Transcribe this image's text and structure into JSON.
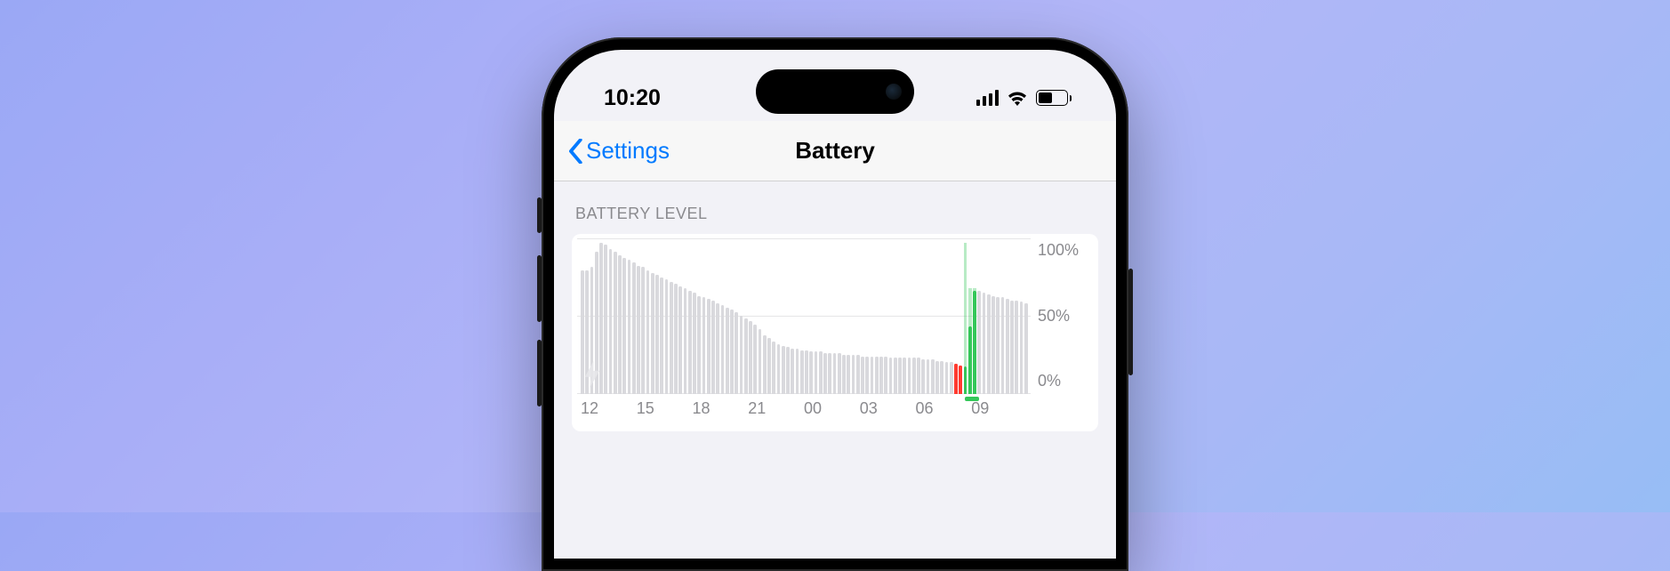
{
  "status_bar": {
    "time": "10:20",
    "cellular_bars": 4,
    "battery_percent": 50
  },
  "nav": {
    "back_label": "Settings",
    "title": "Battery"
  },
  "section": {
    "header": "BATTERY LEVEL"
  },
  "chart_data": {
    "type": "bar",
    "title": "Battery Level",
    "ylabel": "%",
    "ylim": [
      0,
      100
    ],
    "y_ticks": [
      "100%",
      "50%",
      "0%"
    ],
    "x_ticks": [
      "12",
      "15",
      "18",
      "21",
      "00",
      "03",
      "06",
      "09"
    ],
    "series": [
      {
        "name": "battery_level",
        "note": "one sample per ~15 min starting ~10:30 prev day; color=state (gray normal, red low, green charging); charged_to = level reached while plugged in during that interval",
        "points": [
          {
            "t": "10:30",
            "v": 82,
            "color": "gray"
          },
          {
            "t": "10:45",
            "v": 82,
            "color": "gray"
          },
          {
            "t": "11:00",
            "v": 84,
            "color": "gray"
          },
          {
            "t": "11:15",
            "v": 94,
            "color": "gray"
          },
          {
            "t": "11:30",
            "v": 100,
            "color": "gray"
          },
          {
            "t": "11:45",
            "v": 99,
            "color": "gray"
          },
          {
            "t": "12:00",
            "v": 96,
            "color": "gray"
          },
          {
            "t": "12:15",
            "v": 94,
            "color": "gray"
          },
          {
            "t": "12:30",
            "v": 92,
            "color": "gray"
          },
          {
            "t": "12:45",
            "v": 90,
            "color": "gray"
          },
          {
            "t": "13:00",
            "v": 89,
            "color": "gray"
          },
          {
            "t": "13:15",
            "v": 87,
            "color": "gray"
          },
          {
            "t": "13:30",
            "v": 85,
            "color": "gray"
          },
          {
            "t": "13:45",
            "v": 84,
            "color": "gray"
          },
          {
            "t": "14:00",
            "v": 82,
            "color": "gray"
          },
          {
            "t": "14:15",
            "v": 80,
            "color": "gray"
          },
          {
            "t": "14:30",
            "v": 79,
            "color": "gray"
          },
          {
            "t": "14:45",
            "v": 77,
            "color": "gray"
          },
          {
            "t": "15:00",
            "v": 76,
            "color": "gray"
          },
          {
            "t": "15:15",
            "v": 74,
            "color": "gray"
          },
          {
            "t": "15:30",
            "v": 73,
            "color": "gray"
          },
          {
            "t": "15:45",
            "v": 71,
            "color": "gray"
          },
          {
            "t": "16:00",
            "v": 70,
            "color": "gray"
          },
          {
            "t": "16:15",
            "v": 68,
            "color": "gray"
          },
          {
            "t": "16:30",
            "v": 67,
            "color": "gray"
          },
          {
            "t": "16:45",
            "v": 65,
            "color": "gray"
          },
          {
            "t": "17:00",
            "v": 64,
            "color": "gray"
          },
          {
            "t": "17:15",
            "v": 63,
            "color": "gray"
          },
          {
            "t": "17:30",
            "v": 62,
            "color": "gray"
          },
          {
            "t": "17:45",
            "v": 60,
            "color": "gray"
          },
          {
            "t": "18:00",
            "v": 59,
            "color": "gray"
          },
          {
            "t": "18:15",
            "v": 57,
            "color": "gray"
          },
          {
            "t": "18:30",
            "v": 56,
            "color": "gray"
          },
          {
            "t": "18:45",
            "v": 54,
            "color": "gray"
          },
          {
            "t": "19:00",
            "v": 52,
            "color": "gray"
          },
          {
            "t": "19:15",
            "v": 50,
            "color": "gray"
          },
          {
            "t": "19:30",
            "v": 48,
            "color": "gray"
          },
          {
            "t": "19:45",
            "v": 46,
            "color": "gray"
          },
          {
            "t": "20:00",
            "v": 43,
            "color": "gray"
          },
          {
            "t": "20:15",
            "v": 39,
            "color": "gray"
          },
          {
            "t": "20:30",
            "v": 37,
            "color": "gray"
          },
          {
            "t": "20:45",
            "v": 35,
            "color": "gray"
          },
          {
            "t": "21:00",
            "v": 33,
            "color": "gray"
          },
          {
            "t": "21:15",
            "v": 32,
            "color": "gray"
          },
          {
            "t": "21:30",
            "v": 31,
            "color": "gray"
          },
          {
            "t": "21:45",
            "v": 30,
            "color": "gray"
          },
          {
            "t": "22:00",
            "v": 30,
            "color": "gray"
          },
          {
            "t": "22:15",
            "v": 29,
            "color": "gray"
          },
          {
            "t": "22:30",
            "v": 29,
            "color": "gray"
          },
          {
            "t": "22:45",
            "v": 28,
            "color": "gray"
          },
          {
            "t": "23:00",
            "v": 28,
            "color": "gray"
          },
          {
            "t": "23:15",
            "v": 28,
            "color": "gray"
          },
          {
            "t": "23:30",
            "v": 27,
            "color": "gray"
          },
          {
            "t": "23:45",
            "v": 27,
            "color": "gray"
          },
          {
            "t": "00:00",
            "v": 27,
            "color": "gray"
          },
          {
            "t": "00:15",
            "v": 27,
            "color": "gray"
          },
          {
            "t": "00:30",
            "v": 26,
            "color": "gray"
          },
          {
            "t": "00:45",
            "v": 26,
            "color": "gray"
          },
          {
            "t": "01:00",
            "v": 26,
            "color": "gray"
          },
          {
            "t": "01:15",
            "v": 26,
            "color": "gray"
          },
          {
            "t": "01:30",
            "v": 25,
            "color": "gray"
          },
          {
            "t": "01:45",
            "v": 25,
            "color": "gray"
          },
          {
            "t": "02:00",
            "v": 25,
            "color": "gray"
          },
          {
            "t": "02:15",
            "v": 25,
            "color": "gray"
          },
          {
            "t": "02:30",
            "v": 25,
            "color": "gray"
          },
          {
            "t": "02:45",
            "v": 25,
            "color": "gray"
          },
          {
            "t": "03:00",
            "v": 24,
            "color": "gray"
          },
          {
            "t": "03:15",
            "v": 24,
            "color": "gray"
          },
          {
            "t": "03:30",
            "v": 24,
            "color": "gray"
          },
          {
            "t": "03:45",
            "v": 24,
            "color": "gray"
          },
          {
            "t": "04:00",
            "v": 24,
            "color": "gray"
          },
          {
            "t": "04:15",
            "v": 24,
            "color": "gray"
          },
          {
            "t": "04:30",
            "v": 24,
            "color": "gray"
          },
          {
            "t": "04:45",
            "v": 23,
            "color": "gray"
          },
          {
            "t": "05:00",
            "v": 23,
            "color": "gray"
          },
          {
            "t": "05:15",
            "v": 23,
            "color": "gray"
          },
          {
            "t": "05:30",
            "v": 22,
            "color": "gray"
          },
          {
            "t": "05:45",
            "v": 22,
            "color": "gray"
          },
          {
            "t": "06:00",
            "v": 21,
            "color": "gray"
          },
          {
            "t": "06:15",
            "v": 21,
            "color": "gray"
          },
          {
            "t": "06:30",
            "v": 20,
            "color": "red"
          },
          {
            "t": "06:45",
            "v": 19,
            "color": "red"
          },
          {
            "t": "07:00",
            "v": 18,
            "color": "green",
            "charged_to": 100
          },
          {
            "t": "07:15",
            "v": 45,
            "color": "green",
            "charged_to": 70
          },
          {
            "t": "07:30",
            "v": 68,
            "color": "green",
            "charged_to": 70
          },
          {
            "t": "07:45",
            "v": 68,
            "color": "gray"
          },
          {
            "t": "08:00",
            "v": 67,
            "color": "gray"
          },
          {
            "t": "08:15",
            "v": 66,
            "color": "gray"
          },
          {
            "t": "08:30",
            "v": 65,
            "color": "gray"
          },
          {
            "t": "08:45",
            "v": 64,
            "color": "gray"
          },
          {
            "t": "09:00",
            "v": 64,
            "color": "gray"
          },
          {
            "t": "09:15",
            "v": 63,
            "color": "gray"
          },
          {
            "t": "09:30",
            "v": 62,
            "color": "gray"
          },
          {
            "t": "09:45",
            "v": 62,
            "color": "gray"
          },
          {
            "t": "10:00",
            "v": 61,
            "color": "gray"
          },
          {
            "t": "10:15",
            "v": 60,
            "color": "gray"
          }
        ],
        "charging_underline": {
          "from": "07:00",
          "to": "07:30"
        }
      }
    ]
  }
}
